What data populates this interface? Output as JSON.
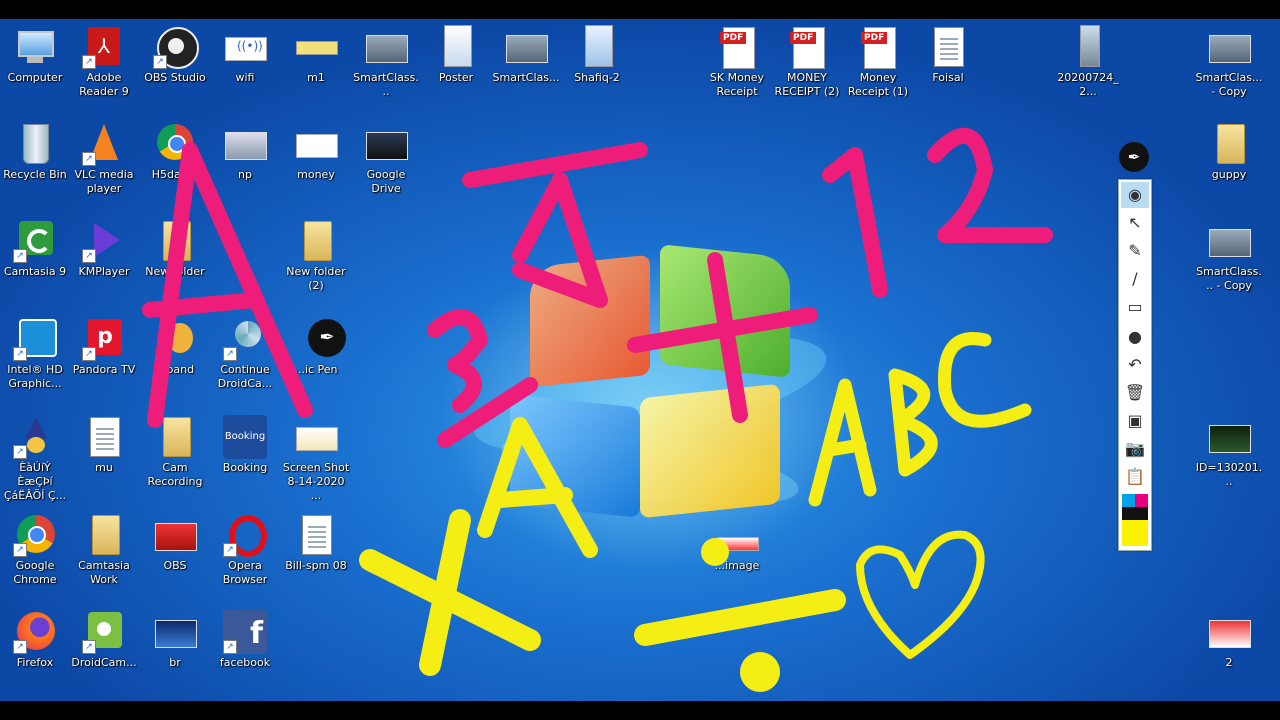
{
  "desktop": {
    "icons": [
      {
        "label": "Computer",
        "icon": "computer-icon"
      },
      {
        "label": "Adobe Reader 9",
        "icon": "adobe-reader-icon"
      },
      {
        "label": "OBS Studio",
        "icon": "obs-studio-icon"
      },
      {
        "label": "wifi",
        "icon": "wifi-icon"
      },
      {
        "label": "m1",
        "icon": "money-receipt-image-icon"
      },
      {
        "label": "SmartClass...",
        "icon": "classroom-photo-icon"
      },
      {
        "label": "Poster",
        "icon": "poster-image-icon"
      },
      {
        "label": "SmartClas...",
        "icon": "classroom-photo-icon"
      },
      {
        "label": "Shafiq-2",
        "icon": "image-file-icon"
      },
      {
        "label": "SK Money Receipt",
        "icon": "pdf-file-icon"
      },
      {
        "label": "MONEY RECEIPT (2)",
        "icon": "pdf-file-icon"
      },
      {
        "label": "Money Receipt (1)",
        "icon": "pdf-file-icon"
      },
      {
        "label": "Foisal",
        "icon": "word-document-icon"
      },
      {
        "label": "20200724_2...",
        "icon": "video-file-icon"
      },
      {
        "label": "SmartClas... - Copy",
        "icon": "classroom-photo-icon"
      },
      {
        "label": "Recycle Bin",
        "icon": "recycle-bin-icon"
      },
      {
        "label": "VLC media player",
        "icon": "vlc-icon"
      },
      {
        "label": "H5da2...",
        "icon": "chrome-shortcut-icon"
      },
      {
        "label": "np",
        "icon": "photo-icon"
      },
      {
        "label": "money",
        "icon": "image-file-icon"
      },
      {
        "label": "Google Drive",
        "icon": "google-drive-icon"
      },
      {
        "label": "guppy",
        "icon": "folder-icon"
      },
      {
        "label": "Camtasia 9",
        "icon": "camtasia-icon"
      },
      {
        "label": "KMPlayer",
        "icon": "kmplayer-icon"
      },
      {
        "label": "New folder",
        "icon": "folder-icon"
      },
      {
        "label": "New folder (2)",
        "icon": "folder-icon"
      },
      {
        "label": "SmartClass... - Copy",
        "icon": "classroom-photo-icon"
      },
      {
        "label": "Intel® HD Graphic...",
        "icon": "intel-graphics-icon"
      },
      {
        "label": "Pandora TV",
        "icon": "pandora-tv-icon"
      },
      {
        "label": "...band",
        "icon": "app-shortcut-icon"
      },
      {
        "label": "Continue DroidCa...",
        "icon": "droidcam-icon"
      },
      {
        "label": "...ic Pen",
        "icon": "epic-pen-icon"
      },
      {
        "label": "ÈàÚíÝ ÈæÇÞí ÇáËÂÖÍ Ç...",
        "icon": "wizard-icon"
      },
      {
        "label": "mu",
        "icon": "word-document-icon"
      },
      {
        "label": "Cam Recording",
        "icon": "folder-icon"
      },
      {
        "label": "Booking",
        "icon": "booking-icon"
      },
      {
        "label": "Screen Shot 8-14-2020 ...",
        "icon": "screenshot-image-icon"
      },
      {
        "label": "ID=130201...",
        "icon": "id-card-image-icon"
      },
      {
        "label": "Google Chrome",
        "icon": "chrome-icon"
      },
      {
        "label": "Camtasia Work",
        "icon": "folder-icon"
      },
      {
        "label": "OBS",
        "icon": "obs-image-icon"
      },
      {
        "label": "Opera Browser",
        "icon": "opera-icon"
      },
      {
        "label": "Bill-spm 08",
        "icon": "word-document-icon"
      },
      {
        "label": "...image",
        "icon": "image-file-icon"
      },
      {
        "label": "Firefox",
        "icon": "firefox-icon"
      },
      {
        "label": "DroidCam...",
        "icon": "droidcam-icon"
      },
      {
        "label": "br",
        "icon": "image-file-icon"
      },
      {
        "label": "facebook",
        "icon": "facebook-icon"
      },
      {
        "label": "2",
        "icon": "id-card-image-icon"
      }
    ]
  },
  "toolbar": {
    "tools": [
      {
        "name": "visibility-eye-icon",
        "glyph": "◉"
      },
      {
        "name": "pointer-arrow-icon",
        "glyph": "↖"
      },
      {
        "name": "highlighter-icon",
        "glyph": "✎"
      },
      {
        "name": "pen-line-icon",
        "glyph": "/"
      },
      {
        "name": "eraser-icon",
        "glyph": "▭"
      },
      {
        "name": "brush-size-icon",
        "glyph": "●"
      },
      {
        "name": "undo-icon",
        "glyph": "↶"
      },
      {
        "name": "trash-icon",
        "glyph": "🗑"
      },
      {
        "name": "whiteboard-icon",
        "glyph": "▣"
      },
      {
        "name": "camera-icon",
        "glyph": "📷"
      },
      {
        "name": "clipboard-icon",
        "glyph": "📋"
      }
    ],
    "top_glyph": "✒",
    "palette_colors": [
      "#00a2e8",
      "#e6007e",
      "#111111",
      "#fff200"
    ]
  },
  "annotations": {
    "pink_color": "#ee1d7a",
    "yellow_color": "#f5ee14"
  }
}
